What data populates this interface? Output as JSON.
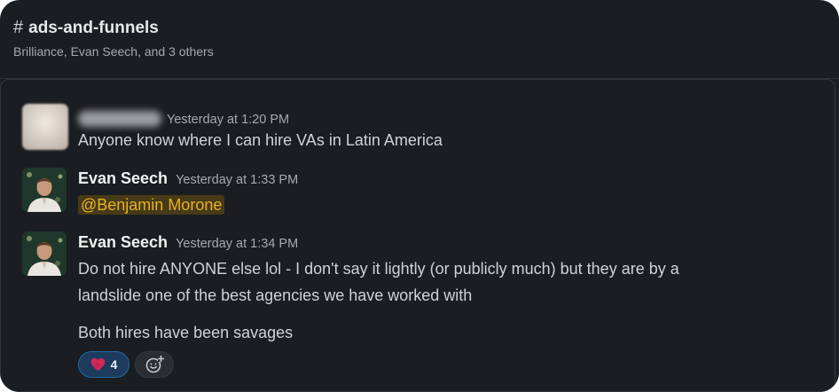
{
  "channel": {
    "name": "ads-and-funnels",
    "members": "Brilliance, Evan Seech, and 3 others"
  },
  "messages": [
    {
      "author": "",
      "timestamp": "Yesterday at 1:20 PM",
      "text": "Anyone know where I can hire VAs in Latin America"
    },
    {
      "author": "Evan Seech",
      "timestamp": "Yesterday at 1:33 PM",
      "mention": "@Benjamin Morone"
    },
    {
      "author": "Evan Seech",
      "timestamp": "Yesterday at 1:34 PM",
      "text_line1": "Do not hire ANYONE else lol - I don't say it lightly (or publicly much) but they are by a",
      "text_line2": "landslide one of the best agencies we have worked with",
      "text_para2": "Both hires have been savages",
      "reactions": [
        {
          "emoji": "heart-icon",
          "count": "4"
        }
      ]
    }
  ],
  "colors": {
    "background": "#1a1d21",
    "mention_bg": "#473a17",
    "mention_text": "#e8b227",
    "reaction_bg": "#1d3b5c",
    "reaction_border": "#1d6aa8"
  }
}
